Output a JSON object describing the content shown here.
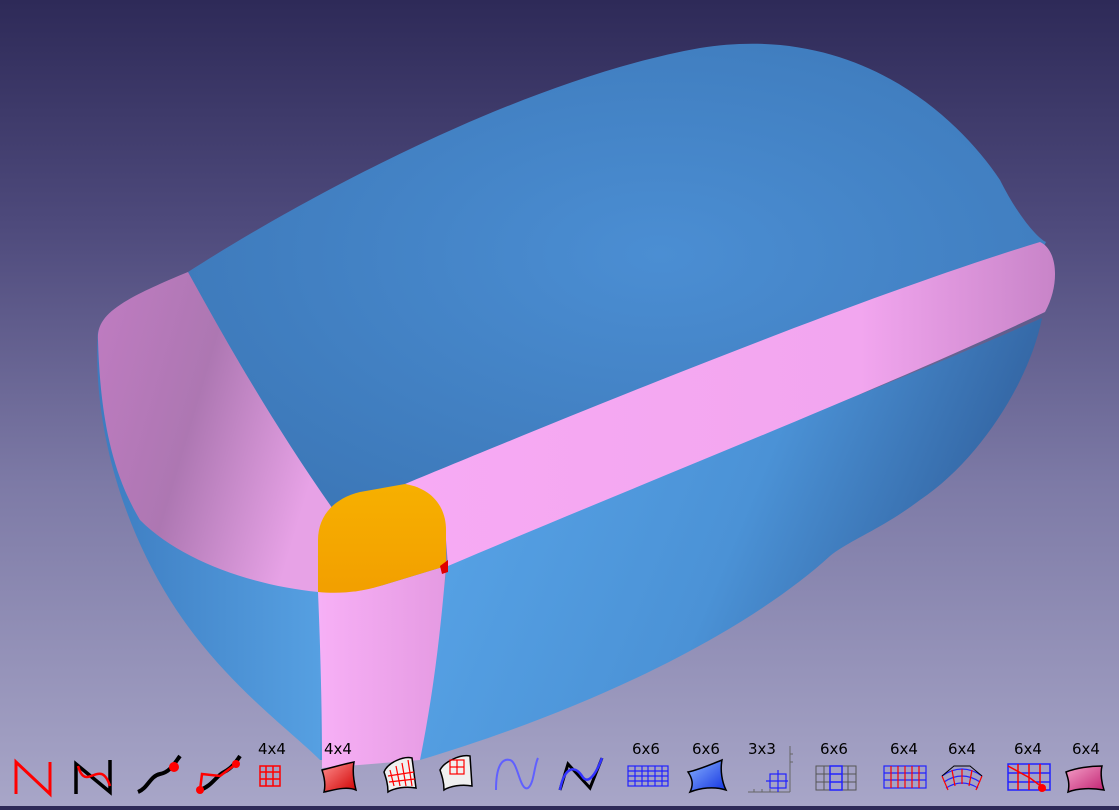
{
  "viewport": {
    "background_top": "#2e2a58",
    "background_bottom": "#a8a6c8",
    "colors": {
      "surface_blue": "#4a8fd0",
      "blend_pink": "#f3a6ee",
      "corner_orange": "#f5a800",
      "marker_red": "#e00000"
    }
  },
  "toolbar": {
    "tools": [
      {
        "icon": "bezier-curve-icon",
        "label": ""
      },
      {
        "icon": "bspline-curve-icon",
        "label": ""
      },
      {
        "icon": "interpolate-curve-icon",
        "label": ""
      },
      {
        "icon": "approximate-curve-icon",
        "label": ""
      },
      {
        "icon": "grid-surface-icon",
        "label": "4x4"
      },
      {
        "icon": "bezier-surface-icon",
        "label": "4x4"
      },
      {
        "icon": "surface-patch-grid-icon",
        "label": ""
      },
      {
        "icon": "surface-patch-icon",
        "label": ""
      },
      {
        "icon": "polyline-curve-icon",
        "label": ""
      },
      {
        "icon": "polyline-control-curve-icon",
        "label": ""
      },
      {
        "icon": "grid-6x6-icon",
        "label": "6x6"
      },
      {
        "icon": "blue-surface-icon",
        "label": "6x6"
      },
      {
        "icon": "partial-grid-icon",
        "label": "3x3"
      },
      {
        "icon": "blend-grid-icon",
        "label": "6x6"
      },
      {
        "icon": "grid-6x4-icon",
        "label": "6x4"
      },
      {
        "icon": "curved-grid-icon",
        "label": "6x4"
      },
      {
        "icon": "trimmed-grid-icon",
        "label": "6x4"
      },
      {
        "icon": "pink-surface-icon",
        "label": "6x4"
      }
    ]
  }
}
